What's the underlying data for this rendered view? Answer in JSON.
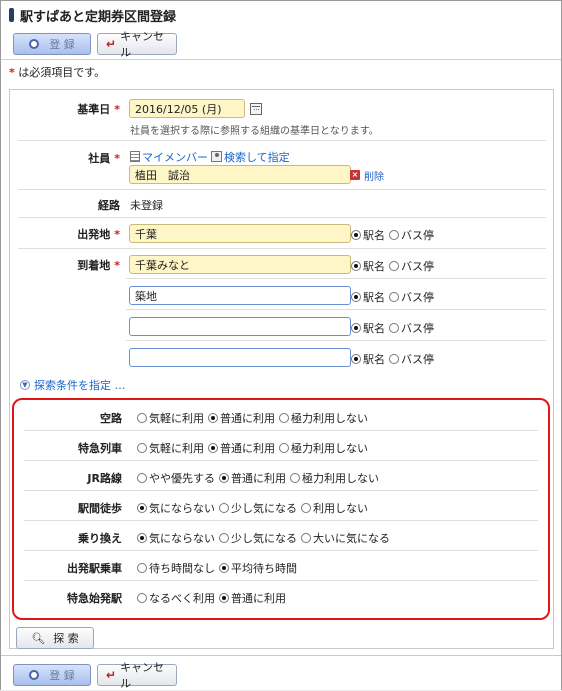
{
  "header": {
    "title": "駅すぱあと定期券区間登録"
  },
  "toolbar": {
    "register_label": "登 録",
    "cancel_label": "キャンセル"
  },
  "required_note": "は必須項目です。",
  "form": {
    "base_date": {
      "label": "基準日",
      "value": "2016/12/05 (月)",
      "hint": "社員を選択する際に参照する組織の基準日となります。"
    },
    "employee": {
      "label": "社員",
      "my_member": "マイメンバー",
      "search_link": "検索して指定",
      "value": "植田　誠治",
      "delete_label": "削除"
    },
    "route": {
      "label": "経路",
      "value": "未登録"
    },
    "departure": {
      "label": "出発地",
      "value": "千葉"
    },
    "arrival": {
      "label": "到着地",
      "value": "千葉みなと"
    },
    "via": [
      {
        "value": "築地"
      },
      {
        "value": ""
      },
      {
        "value": ""
      }
    ],
    "place_options": [
      "駅名",
      "バス停"
    ],
    "search_condition_toggle": "探索条件を指定 …"
  },
  "conditions": [
    {
      "label": "空路",
      "options": [
        "気軽に利用",
        "普通に利用",
        "極力利用しない"
      ],
      "selected": 1
    },
    {
      "label": "特急列車",
      "options": [
        "気軽に利用",
        "普通に利用",
        "極力利用しない"
      ],
      "selected": 1
    },
    {
      "label": "JR路線",
      "options": [
        "やや優先する",
        "普通に利用",
        "極力利用しない"
      ],
      "selected": 1
    },
    {
      "label": "駅間徒歩",
      "options": [
        "気にならない",
        "少し気になる",
        "利用しない"
      ],
      "selected": 0
    },
    {
      "label": "乗り換え",
      "options": [
        "気にならない",
        "少し気になる",
        "大いに気になる"
      ],
      "selected": 0
    },
    {
      "label": "出発駅乗車",
      "options": [
        "待ち時間なし",
        "平均待ち時間"
      ],
      "selected": 1
    },
    {
      "label": "特急始発駅",
      "options": [
        "なるべく利用",
        "普通に利用"
      ],
      "selected": 1
    }
  ],
  "search_button": "探 索",
  "colors": {
    "highlight_box": "#e01616",
    "required": "#d51a1a",
    "link": "#1d63c5",
    "input_required_bg": "#fff6c8"
  }
}
